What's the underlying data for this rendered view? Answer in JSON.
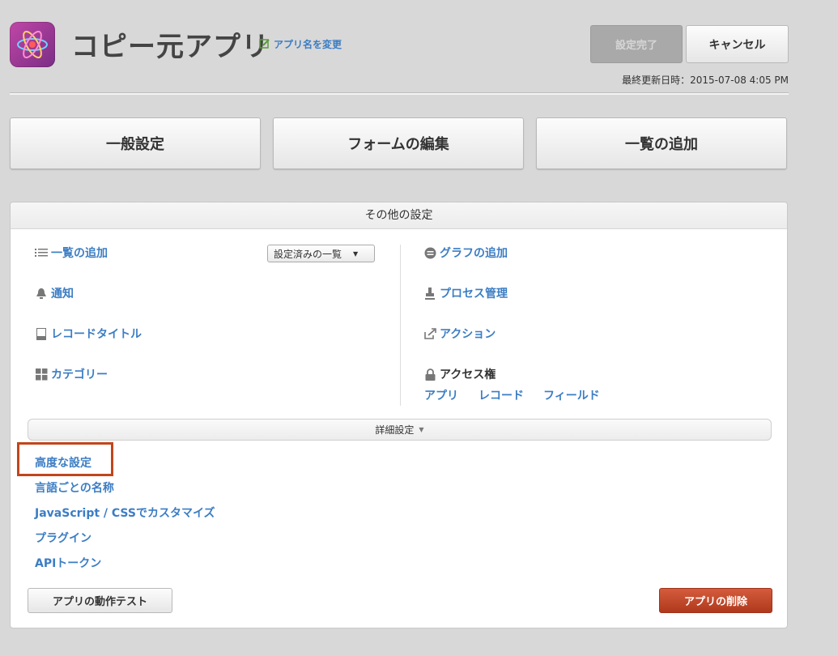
{
  "header": {
    "app_name": "コピー元アプリ",
    "rename_link": "アプリ名を変更",
    "save_button": "設定完了",
    "cancel_button": "キャンセル",
    "last_updated": "最終更新日時：2015-07-08 4:05 PM",
    "app_icon": "atom-icon"
  },
  "tabs": [
    {
      "label": "一般設定"
    },
    {
      "label": "フォームの編集"
    },
    {
      "label": "一覧の追加"
    }
  ],
  "panel": {
    "title": "その他の設定",
    "left_items": [
      {
        "label": "一覧の追加",
        "icon": "list-icon"
      },
      {
        "label": "通知",
        "icon": "bell-icon"
      },
      {
        "label": "レコードタイトル",
        "icon": "document-icon"
      },
      {
        "label": "カテゴリー",
        "icon": "grid-icon"
      }
    ],
    "list_dropdown": "設定済みの一覧",
    "right_items": [
      {
        "label": "グラフの追加",
        "icon": "chart-icon"
      },
      {
        "label": "プロセス管理",
        "icon": "stamp-icon"
      },
      {
        "label": "アクション",
        "icon": "share-icon"
      },
      {
        "label": "アクセス権",
        "icon": "lock-icon"
      }
    ],
    "access_links": [
      "アプリ",
      "レコード",
      "フィールド"
    ],
    "advanced_bar": "詳細設定",
    "advanced_links": [
      "高度な設定",
      "言語ごとの名称",
      "JavaScript / CSSでカスタマイズ",
      "プラグイン",
      "APIトークン"
    ],
    "test_button": "アプリの動作テスト",
    "delete_button": "アプリの削除"
  },
  "colors": {
    "link": "#3b7dc4",
    "highlight": "#c1461b",
    "delete": "#c04a2b"
  }
}
